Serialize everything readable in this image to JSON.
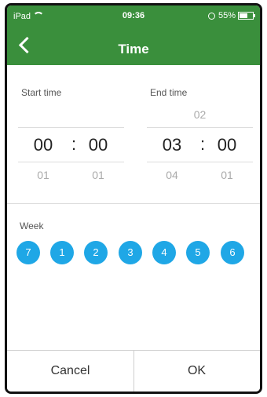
{
  "status_bar": {
    "device": "iPad",
    "time": "09:36",
    "battery": "55%"
  },
  "header": {
    "title": "Time"
  },
  "start_time": {
    "label": "Start time",
    "hour": "00",
    "minute": "00",
    "next_hour": "01",
    "next_minute": "01"
  },
  "end_time": {
    "label": "End time",
    "prev_hour": "02",
    "hour": "03",
    "minute": "00",
    "next_hour": "04",
    "next_minute": "01"
  },
  "separator": ":",
  "week": {
    "label": "Week",
    "days": [
      "7",
      "1",
      "2",
      "3",
      "4",
      "5",
      "6"
    ],
    "color": "#1fa7e6"
  },
  "buttons": {
    "cancel": "Cancel",
    "ok": "OK"
  },
  "colors": {
    "header": "#3a8f3c"
  }
}
